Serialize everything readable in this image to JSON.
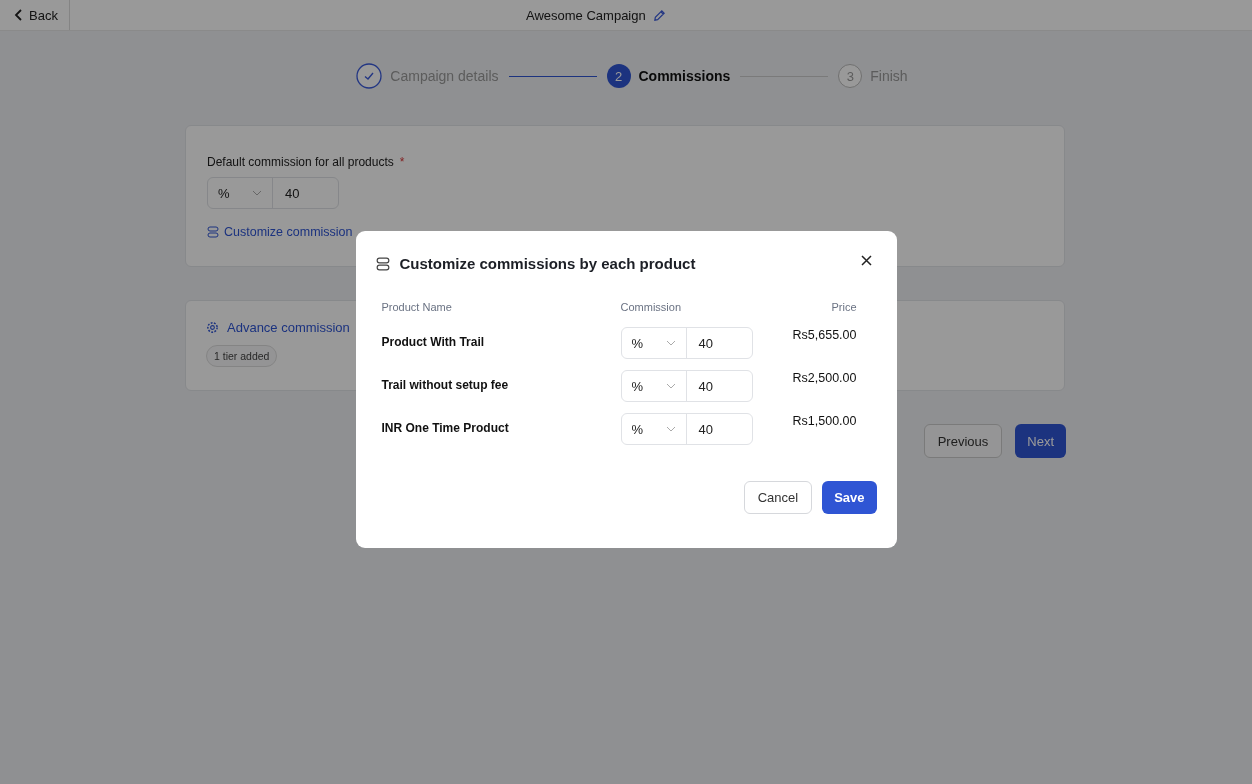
{
  "header": {
    "back": "Back",
    "title": "Awesome Campaign"
  },
  "steps": [
    {
      "label": "Campaign details",
      "completed": true,
      "selected": false
    },
    {
      "number": "2",
      "label": "Commissions",
      "completed": false,
      "selected": true
    },
    {
      "number": "3",
      "label": "Finish",
      "completed": false,
      "selected": false
    }
  ],
  "default_commission": {
    "label": "Default commission for all products",
    "required_mark": "*",
    "unit": "%",
    "value": "40",
    "customize_link": "Customize commission"
  },
  "advanced": {
    "link": "Advance commission",
    "badge": "1 tier added"
  },
  "nav_buttons": {
    "previous": "Previous",
    "next": "Next"
  },
  "modal": {
    "title": "Customize commissions by each product",
    "columns": [
      "Product Name",
      "Commission",
      "Price"
    ],
    "rows": [
      {
        "name": "Product With Trail",
        "unit": "%",
        "value": "40",
        "price": "Rs5,655.00"
      },
      {
        "name": "Trail without setup fee",
        "unit": "%",
        "value": "40",
        "price": "Rs2,500.00"
      },
      {
        "name": "INR One Time Product",
        "unit": "%",
        "value": "40",
        "price": "Rs1,500.00"
      }
    ],
    "cancel": "Cancel",
    "save": "Save"
  }
}
